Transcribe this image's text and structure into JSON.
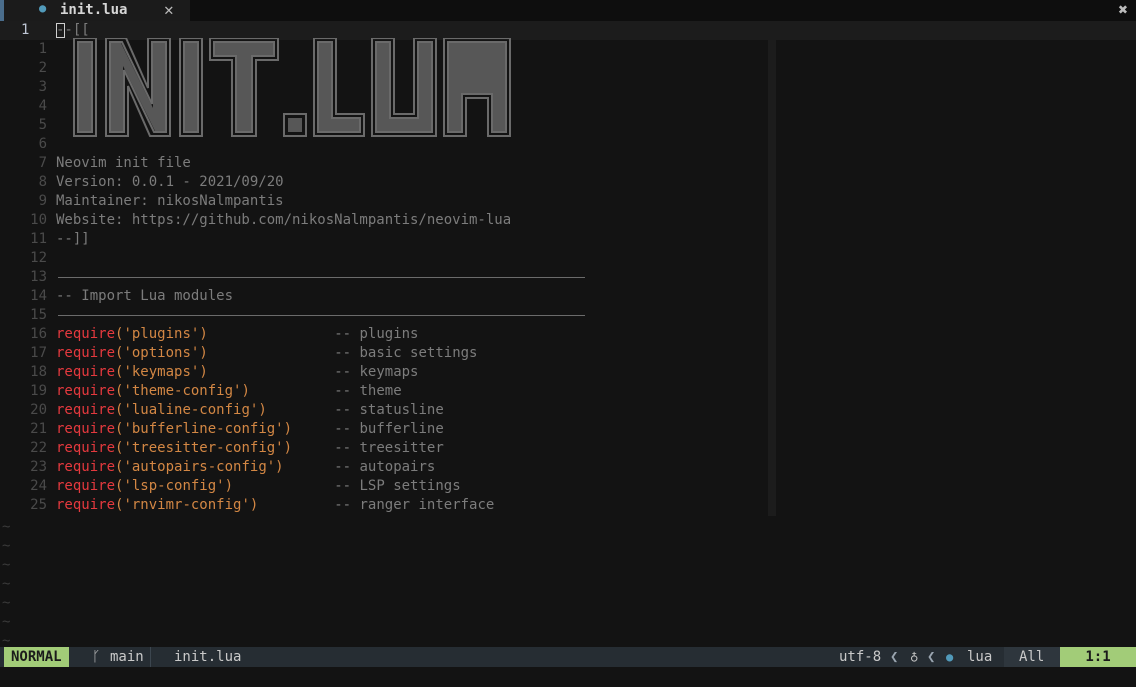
{
  "tabline": {
    "tab_icon": "lua-file-icon",
    "tab_name": "init.lua",
    "tab_close": "✕",
    "window_close": "✖"
  },
  "editor": {
    "current_line_number": "1",
    "current_line_text": "--[[",
    "lines": [
      {
        "n": "1",
        "text": ""
      },
      {
        "n": "2",
        "text": ""
      },
      {
        "n": "3",
        "text": ""
      },
      {
        "n": "4",
        "text": ""
      },
      {
        "n": "5",
        "text": ""
      },
      {
        "n": "6",
        "text": ""
      },
      {
        "n": "7",
        "text": "Neovim init file"
      },
      {
        "n": "8",
        "text": "Version: 0.0.1 - 2021/09/20"
      },
      {
        "n": "9",
        "text": "Maintainer: nikosNalmpantis"
      },
      {
        "n": "10",
        "text": "Website: https://github.com/nikosNalmpantis/neovim-lua"
      },
      {
        "n": "11",
        "text": "--]]"
      },
      {
        "n": "12",
        "text": ""
      },
      {
        "n": "13",
        "text": ""
      },
      {
        "n": "14",
        "text": "-- Import Lua modules"
      },
      {
        "n": "15",
        "text": ""
      }
    ],
    "banner_text": "INIT.LUA",
    "requires": [
      {
        "n": "16",
        "module": "'plugins'",
        "pad": "               ",
        "comment": "-- plugins"
      },
      {
        "n": "17",
        "module": "'options'",
        "pad": "               ",
        "comment": "-- basic settings"
      },
      {
        "n": "18",
        "module": "'keymaps'",
        "pad": "               ",
        "comment": "-- keymaps"
      },
      {
        "n": "19",
        "module": "'theme-config'",
        "pad": "          ",
        "comment": "-- theme"
      },
      {
        "n": "20",
        "module": "'lualine-config'",
        "pad": "        ",
        "comment": "-- statusline"
      },
      {
        "n": "21",
        "module": "'bufferline-config'",
        "pad": "     ",
        "comment": "-- bufferline"
      },
      {
        "n": "22",
        "module": "'treesitter-config'",
        "pad": "     ",
        "comment": "-- treesitter"
      },
      {
        "n": "23",
        "module": "'autopairs-config'",
        "pad": "      ",
        "comment": "-- autopairs"
      },
      {
        "n": "24",
        "module": "'lsp-config'",
        "pad": "            ",
        "comment": "-- LSP settings"
      },
      {
        "n": "25",
        "module": "'rnvimr-config'",
        "pad": "         ",
        "comment": "-- ranger interface"
      }
    ],
    "require_kw": "require",
    "tilde": "~",
    "tilde_count": 7
  },
  "statusline": {
    "mode": "NORMAL",
    "branch_icon": "git-branch-icon",
    "branch": "main",
    "filename": "init.lua",
    "encoding": "utf-8",
    "os_icon": "linux-tux-icon",
    "filetype_icon": "lua-file-icon",
    "filetype": "lua",
    "percent": "All",
    "position": "1:1"
  },
  "colors": {
    "mode_bg": "#a2cc78",
    "keyword": "#e5393e",
    "string": "#d38744",
    "lua_icon": "#519aba"
  }
}
